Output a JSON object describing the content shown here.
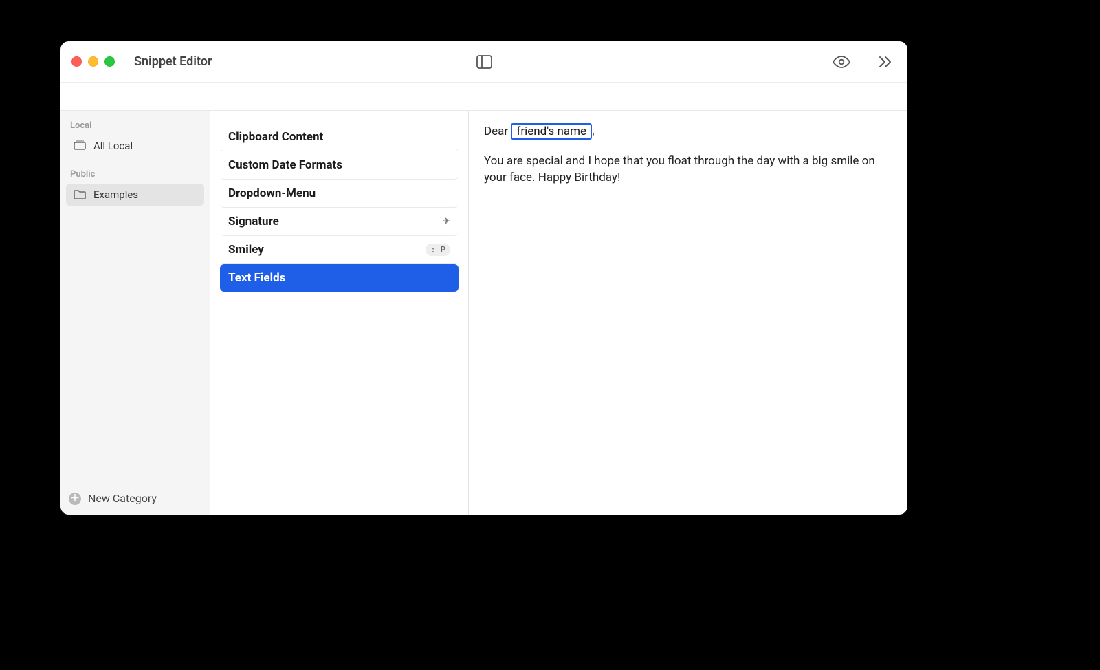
{
  "titlebar": {
    "app_title": "Snippet Editor"
  },
  "sidebar": {
    "sections": [
      {
        "label": "Local",
        "items": [
          {
            "label": "All Local",
            "icon": "stack-icon",
            "selected": false
          }
        ]
      },
      {
        "label": "Public",
        "items": [
          {
            "label": "Examples",
            "icon": "folder-icon",
            "selected": true
          }
        ]
      }
    ],
    "new_category_label": "New Category"
  },
  "snippet_list": {
    "items": [
      {
        "label": "Clipboard Content",
        "trailing": "",
        "selected": false,
        "trailing_kind": "none"
      },
      {
        "label": "Custom Date Formats",
        "trailing": "",
        "selected": false,
        "trailing_kind": "none"
      },
      {
        "label": "Dropdown-Menu",
        "trailing": "",
        "selected": false,
        "trailing_kind": "none"
      },
      {
        "label": "Signature",
        "trailing": "✈︎",
        "selected": false,
        "trailing_kind": "glyph"
      },
      {
        "label": "Smiley",
        "trailing": ":-P",
        "selected": false,
        "trailing_kind": "badge"
      },
      {
        "label": "Text Fields",
        "trailing": "",
        "selected": true,
        "trailing_kind": "none"
      }
    ]
  },
  "editor": {
    "greeting_prefix": "Dear ",
    "field_placeholder": "friend's name",
    "greeting_suffix": ",",
    "body": "You are special and I hope that you float through the day with a big smile on your face. Happy Birthday!"
  }
}
